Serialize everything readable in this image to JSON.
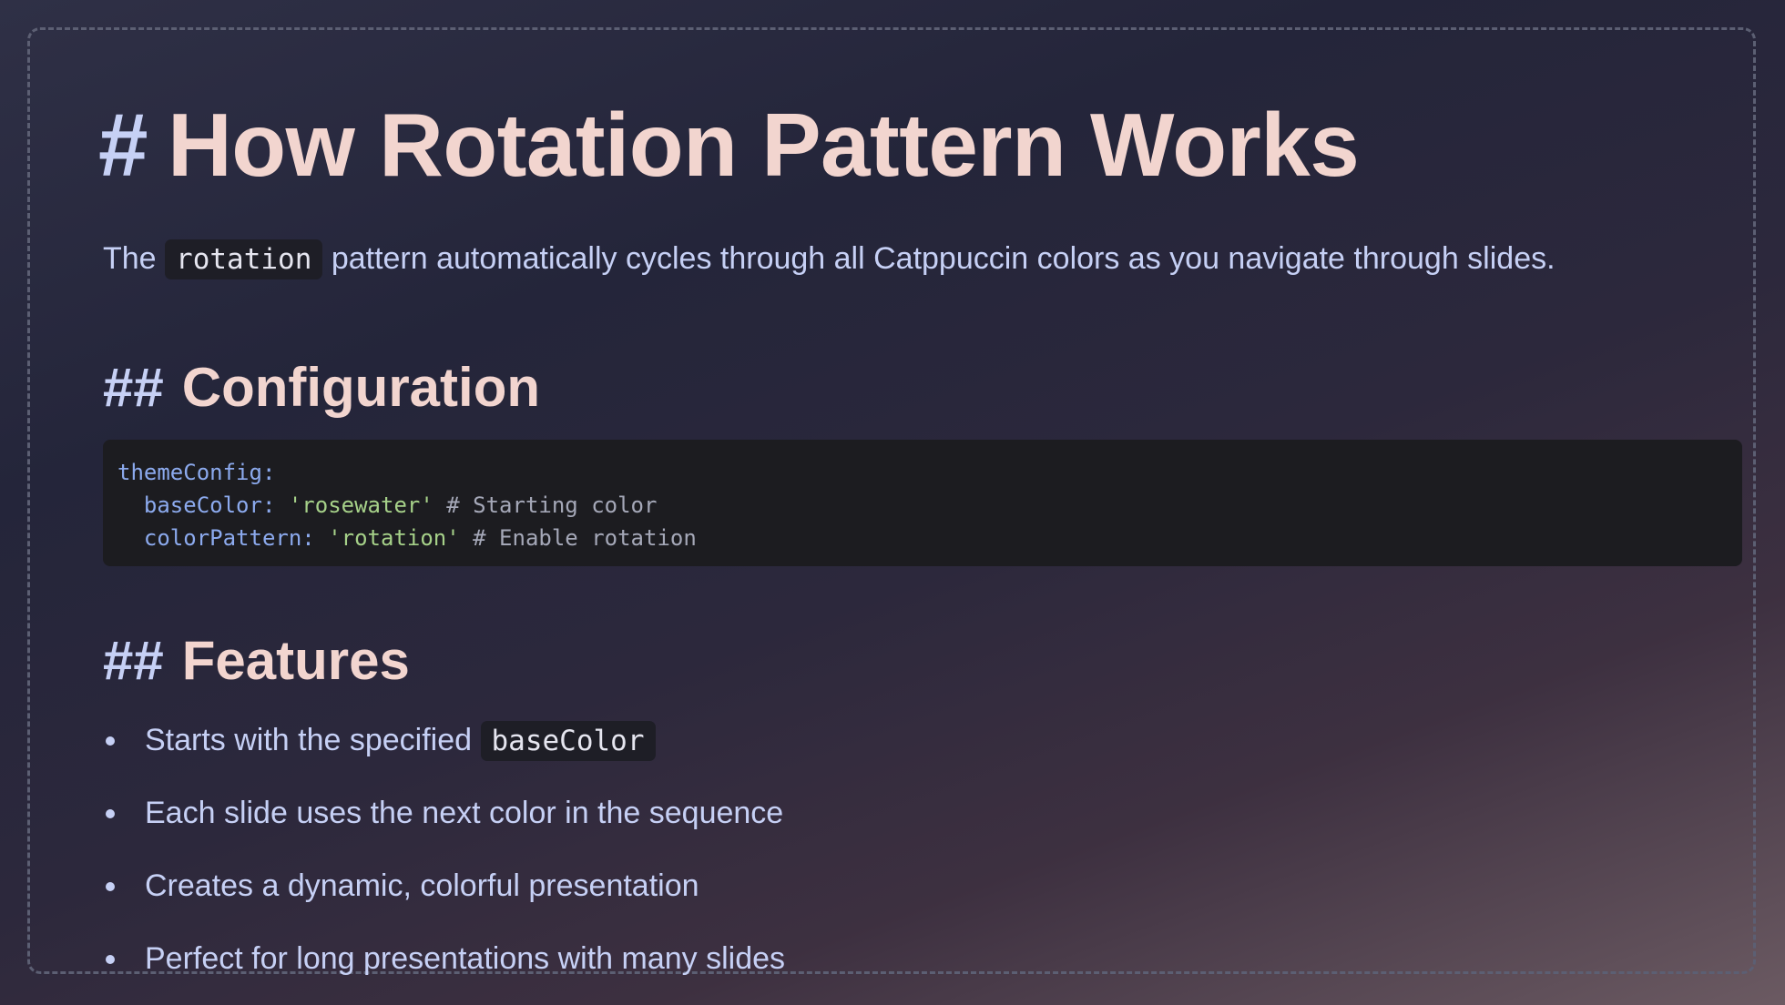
{
  "slide": {
    "title_hash": "#",
    "title": "How Rotation Pattern Works",
    "intro": {
      "before": "The",
      "code": "rotation",
      "after": "pattern automatically cycles through all Catppuccin colors as you navigate through slides."
    },
    "sections": {
      "configuration": {
        "hash": "##",
        "heading": "Configuration",
        "code_lines": [
          {
            "key": "themeConfig",
            "colon": ":"
          },
          {
            "indent": "  ",
            "key": "baseColor",
            "colon": ": ",
            "value": "'rosewater'",
            "comment": " # Starting color"
          },
          {
            "indent": "  ",
            "key": "colorPattern",
            "colon": ": ",
            "value": "'rotation'",
            "comment": " # Enable rotation"
          }
        ]
      },
      "features": {
        "hash": "##",
        "heading": "Features",
        "items": [
          {
            "text": "Starts with the specified",
            "code": "baseColor"
          },
          {
            "text": "Each slide uses the next color in the sequence"
          },
          {
            "text": "Creates a dynamic, colorful presentation"
          },
          {
            "text": "Perfect for long presentations with many slides"
          }
        ]
      }
    }
  },
  "colors": {
    "heading": "#f2d5cf",
    "hash": "#c6d0f5",
    "text": "#c6d0f5",
    "code_key": "#8caaee",
    "code_string": "#a6d189",
    "code_comment": "#a5a8b8",
    "code_background": "#1c1c20"
  }
}
